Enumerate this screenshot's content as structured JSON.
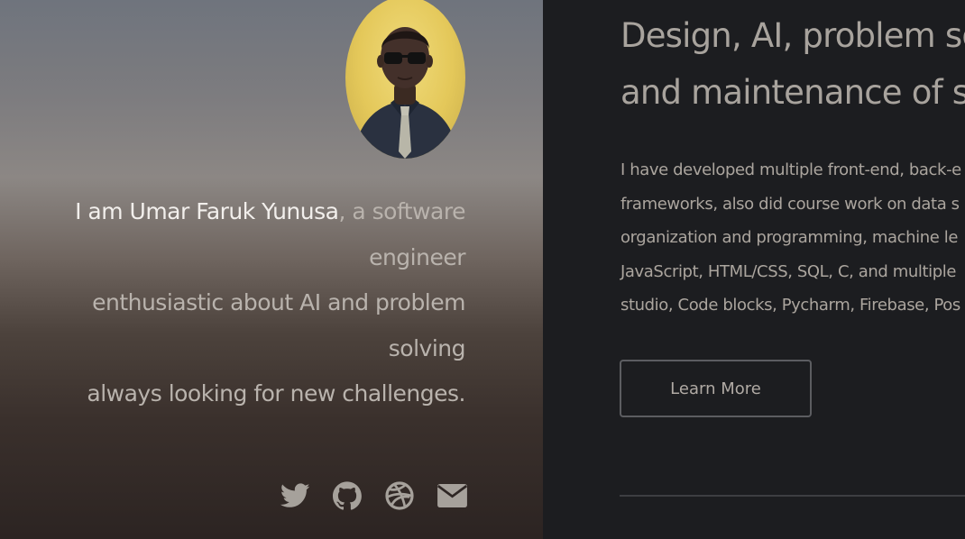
{
  "hero": {
    "name": "I am Umar Faruk Yunusa",
    "intro_line1": ", a software",
    "intro_line2": "engineer",
    "intro_line3": "enthusiastic about AI and problem",
    "intro_line4": "solving",
    "intro_line5": "always looking for new challenges.",
    "social": [
      {
        "icon": "twitter-icon"
      },
      {
        "icon": "github-icon"
      },
      {
        "icon": "dribbble-icon"
      },
      {
        "icon": "envelope-icon"
      }
    ]
  },
  "content": {
    "headline_line1": "Design, AI, problem so",
    "headline_line2": "and maintenance of s",
    "bio_lines": [
      "I have developed multiple front-end, back-e",
      "frameworks, also did course work on data s",
      "organization and programming, machine le",
      "JavaScript, HTML/CSS, SQL, C, and multiple",
      "studio, Code blocks, Pycharm, Firebase, Pos"
    ],
    "learn_more_label": "Learn More"
  },
  "colors": {
    "page_background": "#1c1d20",
    "text_muted": "#aba59e",
    "text_bright": "#f2efec",
    "icon": "#a6a19b",
    "avatar_background": "#e4c85a"
  }
}
